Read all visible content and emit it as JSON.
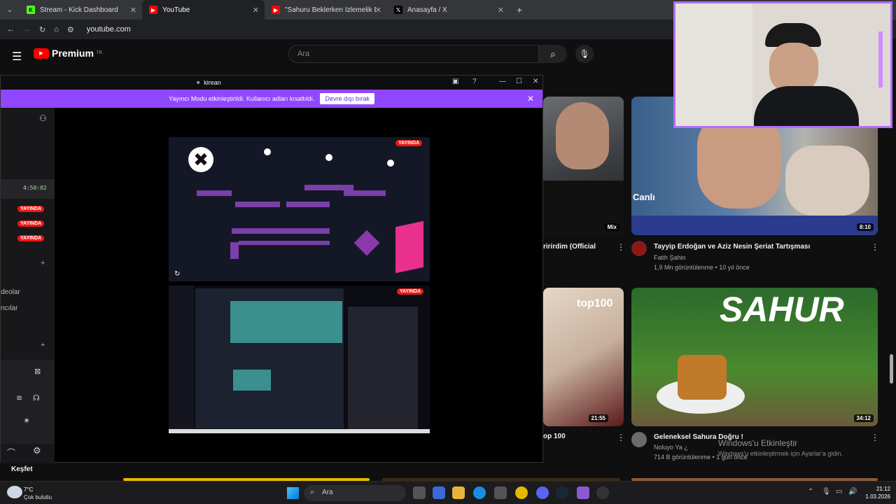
{
  "browser": {
    "tabs": [
      {
        "label": "Stream - Kick Dashboard",
        "favicon": "kick-icon",
        "color": "#53fc18",
        "active": false
      },
      {
        "label": "YouTube",
        "favicon": "youtube-icon",
        "color": "#ff0000",
        "active": true
      },
      {
        "label": "\"Sahuru Beklerken İzlemelik Ed",
        "favicon": "youtube-icon",
        "color": "#ff0000",
        "active": false
      },
      {
        "label": "Anasayfa / X",
        "favicon": "x-icon",
        "color": "#000000",
        "active": false
      }
    ],
    "new_tab": "+",
    "url": "youtube.com"
  },
  "youtube": {
    "logo": "Premium",
    "logo_sup": "TR",
    "search_placeholder": "Ara",
    "sidebar_explore": "Keşfet",
    "videos": [
      {
        "title": "ririrdim (Official",
        "channel": "",
        "meta": "",
        "badge": "Mix"
      },
      {
        "title": "Tayyip Erdoğan ve Aziz Nesin Şeriat Tartışması",
        "channel": "Fatih Şahin",
        "meta": "1,9 Mn görüntülenme • 10 yıl önce",
        "badge": "8:10",
        "overlay": "Canlı"
      },
      {
        "title": "op 100",
        "channel": "",
        "meta": "",
        "badge": "21:55",
        "overlay": "top100"
      },
      {
        "title": "Geleneksel Sahura Doğru !",
        "channel": "Noluyo Ya ¿",
        "meta": "714 B görüntülenme • 1 gün önce",
        "badge": "34:12",
        "overlay": "SAHUR"
      }
    ]
  },
  "kick": {
    "window_title": "kirean",
    "banner_text": "Yayıncı Modu etkinleştirildi. Kullanıcı adları kısaltıldı.",
    "banner_button": "Devre dışı bırak",
    "uptime": "4:50:02",
    "live_label": "YAYINDA",
    "side_partial_1": "deolar",
    "side_partial_2": "ncılar"
  },
  "windows": {
    "activate_title": "Windows'u Etkinleştir",
    "activate_sub": "Windows'u etkinleştirmek için Ayarlar'a gidin.",
    "weather_temp": "7°C",
    "weather_desc": "Çok bulutlu",
    "search_label": "Ara",
    "time": "21:12",
    "date": "1.03.2026"
  }
}
